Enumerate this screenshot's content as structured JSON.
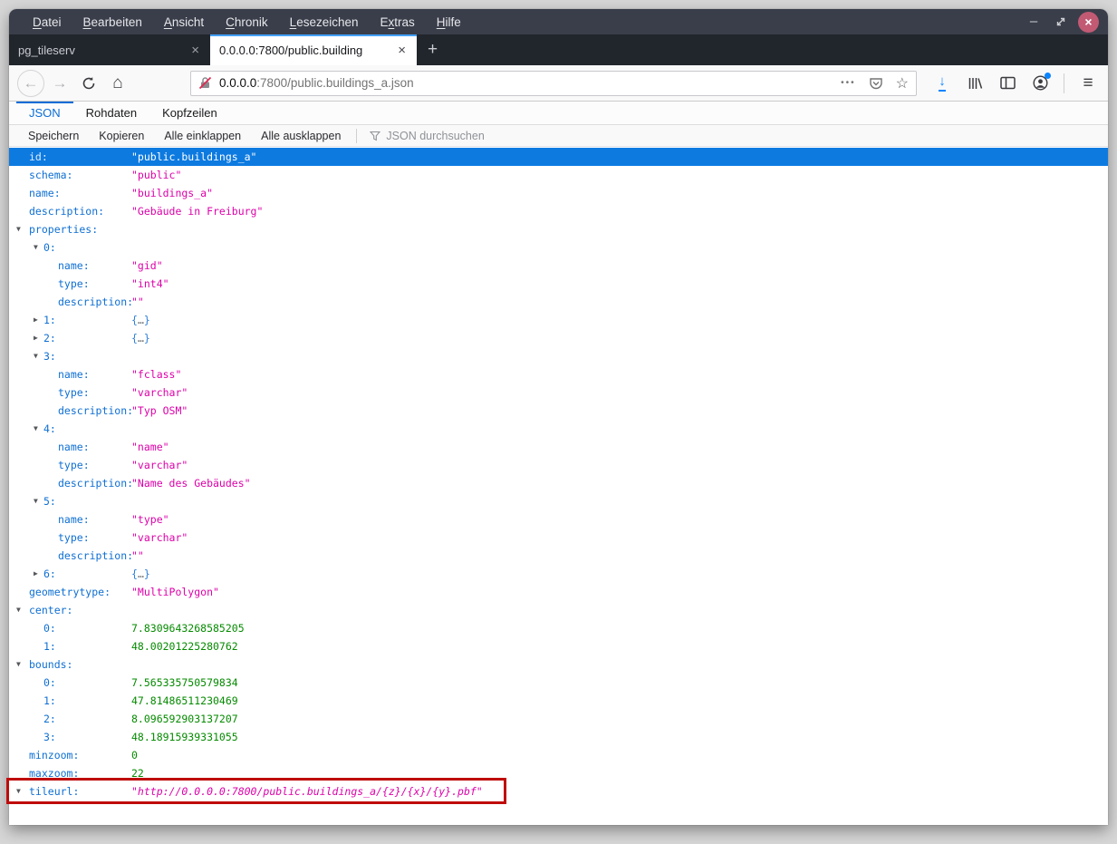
{
  "window_chrome": {
    "menu": [
      {
        "label": "Datei",
        "u": 0
      },
      {
        "label": "Bearbeiten",
        "u": 0
      },
      {
        "label": "Ansicht",
        "u": 0
      },
      {
        "label": "Chronik",
        "u": 0
      },
      {
        "label": "Lesezeichen",
        "u": 0
      },
      {
        "label": "Extras",
        "u": 1
      },
      {
        "label": "Hilfe",
        "u": 0
      }
    ],
    "controls": {
      "minimize_glyph": "–",
      "close_glyph": "×"
    }
  },
  "browser_tabs": {
    "tabs": [
      {
        "title": "pg_tileserv",
        "active": false,
        "close_glyph": "×"
      },
      {
        "title": "0.0.0.0:7800/public.building",
        "active": true,
        "close_glyph": "×"
      }
    ],
    "new_tab_glyph": "+"
  },
  "navbar": {
    "back_glyph": "←",
    "forward_glyph": "→",
    "home_glyph": "⌂",
    "url_domain": "0.0.0.0",
    "url_rest": ":7800/public.buildings_a.json",
    "page_actions_glyph": "•••",
    "bookmark_star_glyph": "☆",
    "download_glyph": "↓",
    "menu_glyph": "≡"
  },
  "json_viewer": {
    "tabs": [
      {
        "label": "JSON",
        "active": true
      },
      {
        "label": "Rohdaten",
        "active": false
      },
      {
        "label": "Kopfzeilen",
        "active": false
      }
    ],
    "toolbar_buttons": [
      "Speichern",
      "Kopieren",
      "Alle einklappen",
      "Alle ausklappen"
    ],
    "search_placeholder": "JSON durchsuchen"
  },
  "tree": {
    "expander_open": "▼",
    "expander_closed": "▶",
    "rows": [
      {
        "indent": 0,
        "exp": null,
        "key": "id",
        "val": "\"public.buildings_a\"",
        "vtype": "str",
        "sel": true
      },
      {
        "indent": 0,
        "exp": null,
        "key": "schema",
        "val": "\"public\"",
        "vtype": "str"
      },
      {
        "indent": 0,
        "exp": null,
        "key": "name",
        "val": "\"buildings_a\"",
        "vtype": "str"
      },
      {
        "indent": 0,
        "exp": null,
        "key": "description",
        "val": "\"Gebäude in Freiburg\"",
        "vtype": "str"
      },
      {
        "indent": 0,
        "exp": "open",
        "key": "properties",
        "val": null,
        "vtype": null
      },
      {
        "indent": 1,
        "exp": "open",
        "key": "0",
        "val": null,
        "vtype": null
      },
      {
        "indent": 2,
        "exp": null,
        "key": "name",
        "val": "\"gid\"",
        "vtype": "str"
      },
      {
        "indent": 2,
        "exp": null,
        "key": "type",
        "val": "\"int4\"",
        "vtype": "str"
      },
      {
        "indent": 2,
        "exp": null,
        "key": "description",
        "val": "\"\"",
        "vtype": "str"
      },
      {
        "indent": 1,
        "exp": "closed",
        "key": "1",
        "val": "{…}",
        "vtype": "obj"
      },
      {
        "indent": 1,
        "exp": "closed",
        "key": "2",
        "val": "{…}",
        "vtype": "obj"
      },
      {
        "indent": 1,
        "exp": "open",
        "key": "3",
        "val": null,
        "vtype": null
      },
      {
        "indent": 2,
        "exp": null,
        "key": "name",
        "val": "\"fclass\"",
        "vtype": "str"
      },
      {
        "indent": 2,
        "exp": null,
        "key": "type",
        "val": "\"varchar\"",
        "vtype": "str"
      },
      {
        "indent": 2,
        "exp": null,
        "key": "description",
        "val": "\"Typ OSM\"",
        "vtype": "str"
      },
      {
        "indent": 1,
        "exp": "open",
        "key": "4",
        "val": null,
        "vtype": null
      },
      {
        "indent": 2,
        "exp": null,
        "key": "name",
        "val": "\"name\"",
        "vtype": "str"
      },
      {
        "indent": 2,
        "exp": null,
        "key": "type",
        "val": "\"varchar\"",
        "vtype": "str"
      },
      {
        "indent": 2,
        "exp": null,
        "key": "description",
        "val": "\"Name des Gebäudes\"",
        "vtype": "str"
      },
      {
        "indent": 1,
        "exp": "open",
        "key": "5",
        "val": null,
        "vtype": null
      },
      {
        "indent": 2,
        "exp": null,
        "key": "name",
        "val": "\"type\"",
        "vtype": "str"
      },
      {
        "indent": 2,
        "exp": null,
        "key": "type",
        "val": "\"varchar\"",
        "vtype": "str"
      },
      {
        "indent": 2,
        "exp": null,
        "key": "description",
        "val": "\"\"",
        "vtype": "str"
      },
      {
        "indent": 1,
        "exp": "closed",
        "key": "6",
        "val": "{…}",
        "vtype": "obj"
      },
      {
        "indent": 0,
        "exp": null,
        "key": "geometrytype",
        "val": "\"MultiPolygon\"",
        "vtype": "str"
      },
      {
        "indent": 0,
        "exp": "open",
        "key": "center",
        "val": null,
        "vtype": null
      },
      {
        "indent": 1,
        "exp": null,
        "key": "0",
        "val": "7.8309643268585205",
        "vtype": "num"
      },
      {
        "indent": 1,
        "exp": null,
        "key": "1",
        "val": "48.00201225280762",
        "vtype": "num"
      },
      {
        "indent": 0,
        "exp": "open",
        "key": "bounds",
        "val": null,
        "vtype": null
      },
      {
        "indent": 1,
        "exp": null,
        "key": "0",
        "val": "7.565335750579834",
        "vtype": "num"
      },
      {
        "indent": 1,
        "exp": null,
        "key": "1",
        "val": "47.81486511230469",
        "vtype": "num"
      },
      {
        "indent": 1,
        "exp": null,
        "key": "2",
        "val": "8.096592903137207",
        "vtype": "num"
      },
      {
        "indent": 1,
        "exp": null,
        "key": "3",
        "val": "48.18915939331055",
        "vtype": "num"
      },
      {
        "indent": 0,
        "exp": null,
        "key": "minzoom",
        "val": "0",
        "vtype": "num"
      },
      {
        "indent": 0,
        "exp": null,
        "key": "maxzoom",
        "val": "22",
        "vtype": "num"
      },
      {
        "indent": 0,
        "exp": "open",
        "key": "tileurl",
        "val": "\"http://0.0.0.0:7800/public.buildings_a/{z}/{x}/{y}.pbf\"",
        "vtype": "str",
        "italic": true,
        "boxed": true
      }
    ]
  },
  "colors": {
    "titlebar": "#3a3e4a",
    "tabbar": "#21252c",
    "active_tab_stripe": "#45a1ff",
    "selection_blue": "#0d7ae0",
    "key_blue": "#0e6fd3",
    "string_magenta": "#dd00a9",
    "number_green": "#058b00",
    "annotation_red": "#bf0b0b",
    "download_blue": "#0a84ff",
    "close_button": "#c25a74"
  }
}
